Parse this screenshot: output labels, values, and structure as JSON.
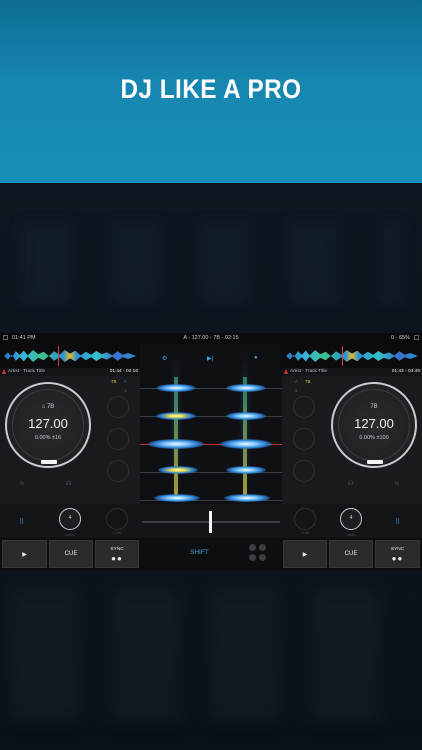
{
  "banner": {
    "headline": "DJ LIKE A PRO"
  },
  "statusbar": {
    "time": "01:41 PM",
    "center": "A - 127.00 - 7B - 02:15",
    "right": "0 - 65%"
  },
  "deck_left": {
    "track_title": "Artist - Track Title",
    "time": "01:44 - 02:16",
    "key": "7B",
    "bpm": "127.00",
    "pitch": "0.00%  ±16",
    "gain_value": "4",
    "gain_label": "GAIN",
    "low_label": "LOW",
    "flags": [
      "7B",
      "5"
    ],
    "flags2": [
      "3"
    ]
  },
  "deck_right": {
    "track_title": "Artist - Track Title",
    "time": "01:43 - 03:49",
    "key": "7B",
    "bpm": "127.00",
    "pitch": "0.00%  ±100",
    "gain_value": "4",
    "gain_label": "GAIN",
    "low_label": "LOW",
    "flags": [
      "7B"
    ],
    "flags2": [
      "3"
    ]
  },
  "buttons": {
    "cue": "CUE",
    "sync": "SYNC",
    "shift": "SHIFT",
    "play_icon": "play-icon",
    "sync_dots": "●●"
  },
  "icons": {
    "play": "▶",
    "grid": "grid-icon",
    "headphone": "headphone-icon"
  },
  "colors": {
    "banner": "#168fb8",
    "accent": "#3ea0e0",
    "playhead": "#e23a3a"
  }
}
